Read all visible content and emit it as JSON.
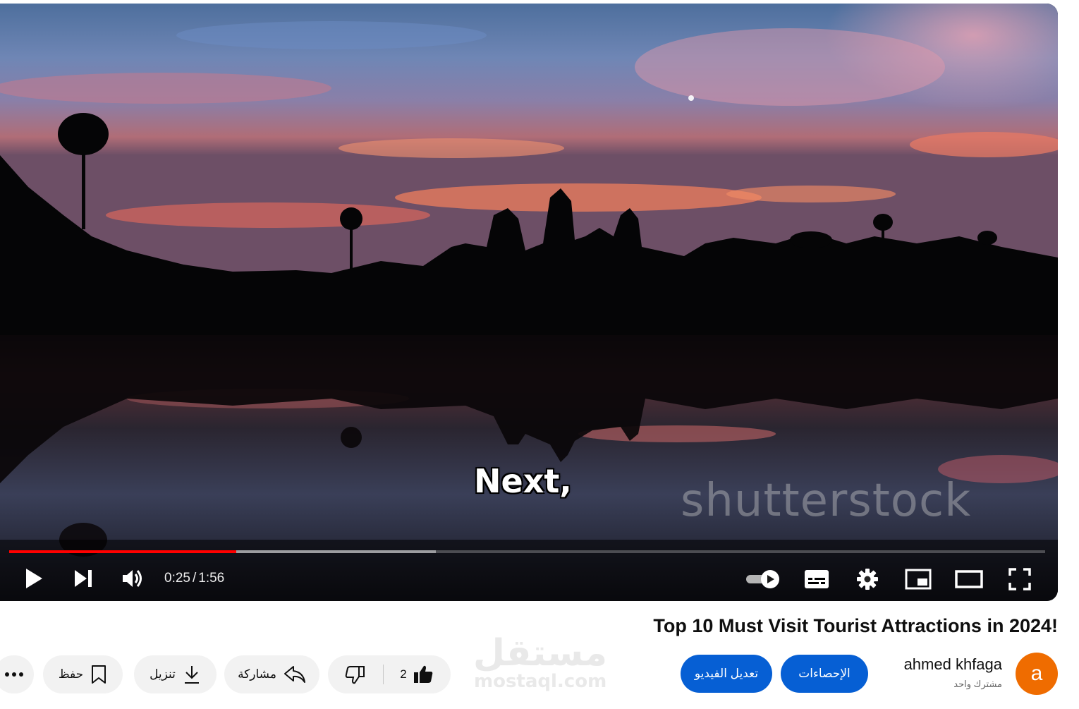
{
  "player": {
    "caption": "Next,",
    "watermark": "shutterstock",
    "time_current": "0:25",
    "time_separator": "/",
    "time_total": "1:56",
    "progress_played_fraction": 0.219,
    "progress_buffered_fraction": 0.412,
    "accent_color": "#ff0000",
    "icons": [
      "play-icon",
      "next-icon",
      "volume-icon",
      "autoplay-toggle-icon",
      "subtitles-icon",
      "settings-gear-icon",
      "miniplayer-icon",
      "theater-mode-icon",
      "fullscreen-icon"
    ]
  },
  "video": {
    "title": "Top 10 Must Visit Tourist Attractions in 2024!"
  },
  "channel": {
    "avatar_letter": "a",
    "avatar_color": "#ef6c00",
    "name": "ahmed khfaga",
    "subscribers": "مشترك واحد"
  },
  "actions": {
    "stats_label": "الإحصاءات",
    "edit_label": "تعديل الفيديو",
    "like_count": "2",
    "share_label": "مشاركة",
    "download_label": "تنزيل",
    "save_label": "حفظ",
    "button_color": "#065fd4"
  },
  "site_watermark": {
    "arabic": "مستقل",
    "latin": "mostaql.com"
  }
}
